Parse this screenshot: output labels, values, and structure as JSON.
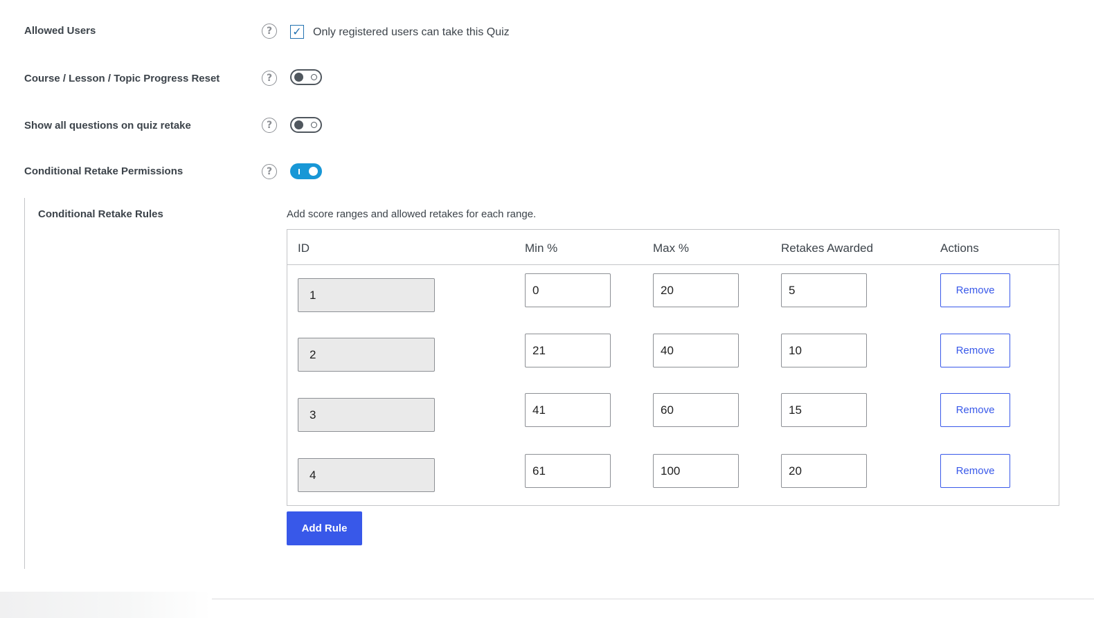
{
  "settings": {
    "allowed_users": {
      "label": "Allowed Users",
      "help_icon": "?",
      "checkbox_checked": true,
      "checkbox_label": "Only registered users can take this Quiz"
    },
    "progress_reset": {
      "label": "Course / Lesson / Topic Progress Reset",
      "help_icon": "?",
      "enabled": false
    },
    "show_all_questions": {
      "label": "Show all questions on quiz retake",
      "help_icon": "?",
      "enabled": false
    },
    "conditional_retake": {
      "label": "Conditional Retake Permissions",
      "help_icon": "?",
      "enabled": true
    }
  },
  "rules": {
    "label": "Conditional Retake Rules",
    "description": "Add score ranges and allowed retakes for each range.",
    "columns": [
      "ID",
      "Min %",
      "Max %",
      "Retakes Awarded",
      "Actions"
    ],
    "rows": [
      {
        "id": "1",
        "min": "0",
        "max": "20",
        "retakes": "5",
        "action": "Remove"
      },
      {
        "id": "2",
        "min": "21",
        "max": "40",
        "retakes": "10",
        "action": "Remove"
      },
      {
        "id": "3",
        "min": "41",
        "max": "60",
        "retakes": "15",
        "action": "Remove"
      },
      {
        "id": "4",
        "min": "61",
        "max": "100",
        "retakes": "20",
        "action": "Remove"
      }
    ],
    "add_button": "Add Rule"
  },
  "colors": {
    "accent": "#3858e9",
    "toggle_on": "#1897d6",
    "checkbox": "#2271b1"
  },
  "icons": {
    "help": "help-circle-icon",
    "check": "checkmark-icon"
  }
}
